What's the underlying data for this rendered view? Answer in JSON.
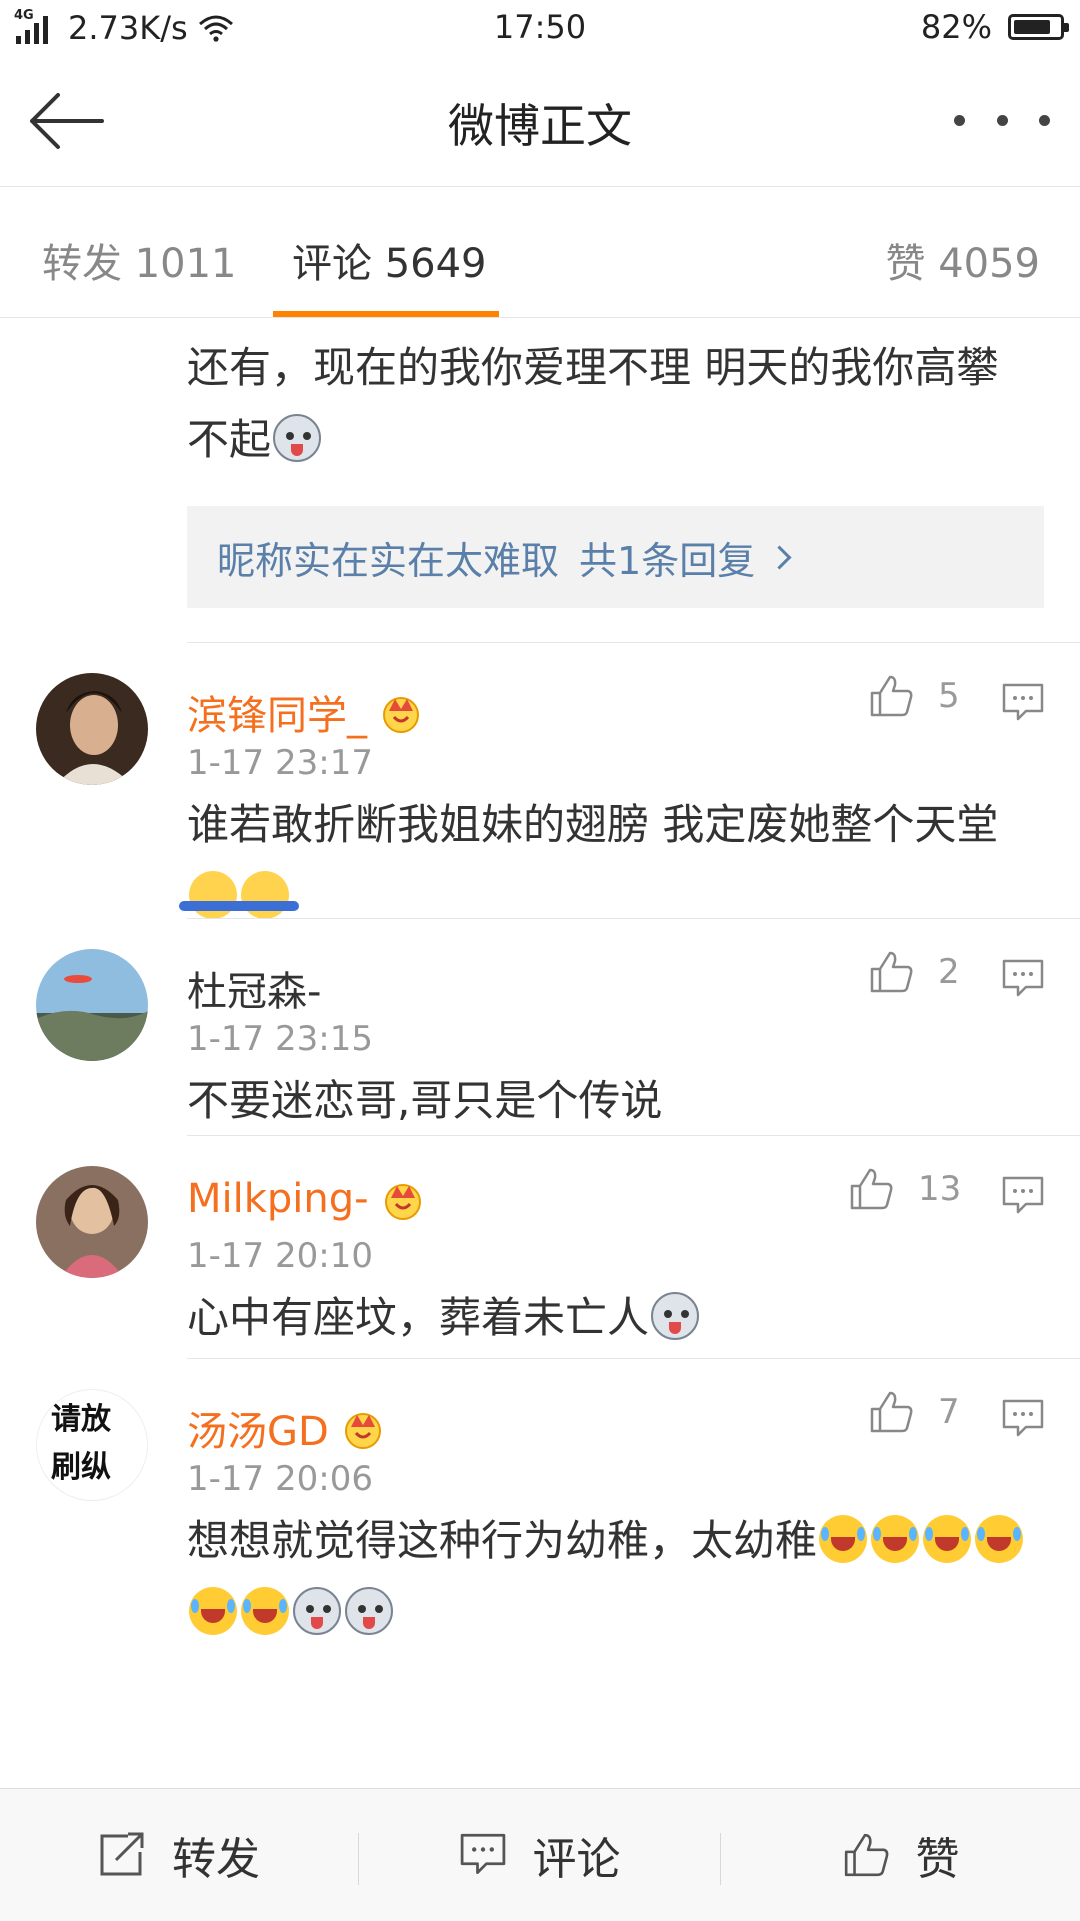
{
  "status_bar": {
    "network": "4G",
    "speed": "2.73K/s",
    "time": "17:50",
    "battery": "82%",
    "battery_level": 0.82
  },
  "nav": {
    "title": "微博正文"
  },
  "tabs": [
    {
      "label": "转发 1011"
    },
    {
      "label": "评论 5649"
    },
    {
      "label": "赞 4059"
    }
  ],
  "first_comment": {
    "text": "还有，现在的我你爱理不理 明天的我你高攀不起",
    "reply_user": "昵称实在实在太难取",
    "reply_count": "共1条回复"
  },
  "comments": [
    {
      "username": "滨锋同学_",
      "time": "1-17 23:17",
      "likes": "5",
      "text": "谁若敢折断我姐妹的翅膀 我定废她整个天堂"
    },
    {
      "username": "杜冠森-",
      "time": "1-17 23:15",
      "likes": "2",
      "text": "不要迷恋哥,哥只是个传说"
    },
    {
      "username": "Milkping-",
      "time": "1-17 20:10",
      "likes": "13",
      "text": "心中有座坟，葬着未亡人"
    },
    {
      "username": "汤汤GD",
      "time": "1-17 20:06",
      "likes": "7",
      "text": "想想就觉得这种行为幼稚，太幼稚",
      "avatar_text": [
        "请放",
        "刷纵"
      ]
    }
  ],
  "bottom_bar": {
    "repost": "转发",
    "comment": "评论",
    "like": "赞"
  },
  "colors": {
    "accent": "#ff8200",
    "username_orange": "#f46f1e",
    "link_blue": "#5a7fa8"
  }
}
